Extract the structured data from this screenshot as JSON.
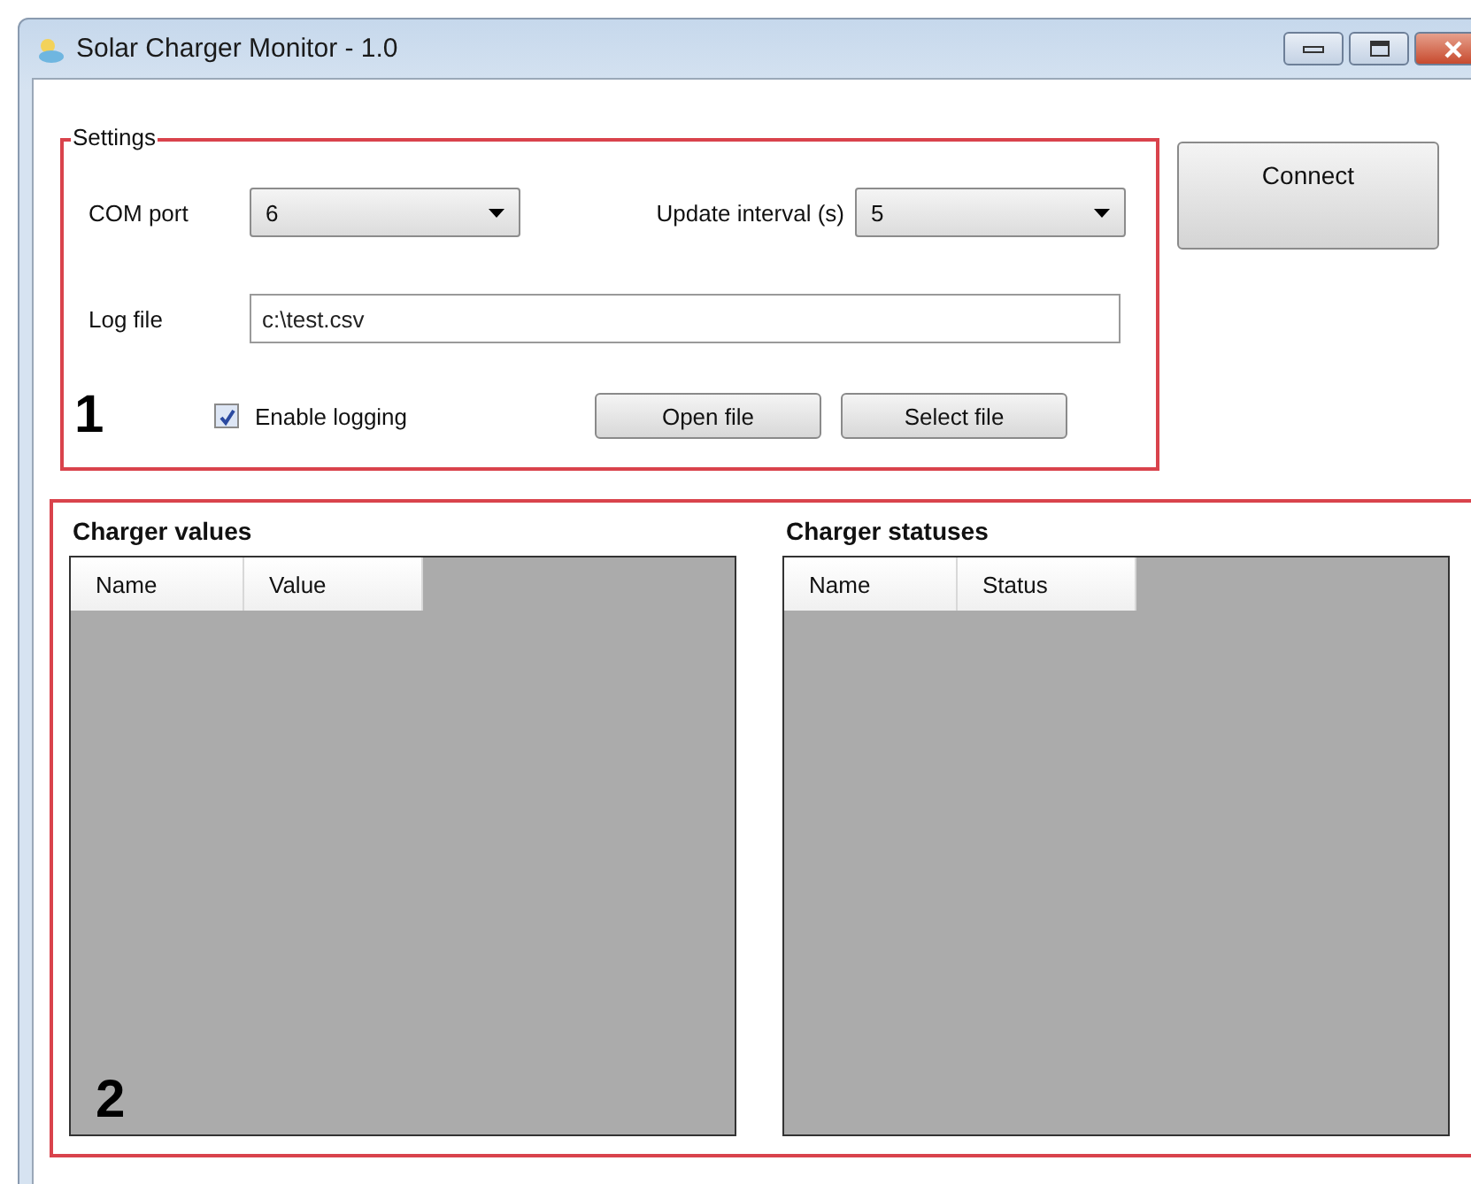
{
  "window": {
    "title": "Solar Charger Monitor - 1.0"
  },
  "settings": {
    "title": "Settings",
    "marker": "1",
    "com_port": {
      "label": "COM port",
      "value": "6"
    },
    "update_interval": {
      "label": "Update interval (s)",
      "value": "5"
    },
    "log_file": {
      "label": "Log file",
      "value": "c:\\test.csv"
    },
    "enable_logging": {
      "label": "Enable logging",
      "checked": true
    },
    "buttons": [
      "Open file",
      "Select file"
    ]
  },
  "connect_button": "Connect",
  "panels": {
    "marker": "2",
    "lists": [
      {
        "title": "Charger values",
        "columns": [
          "Name",
          "Value"
        ]
      },
      {
        "title": "Charger statuses",
        "columns": [
          "Name",
          "Status"
        ]
      }
    ]
  }
}
